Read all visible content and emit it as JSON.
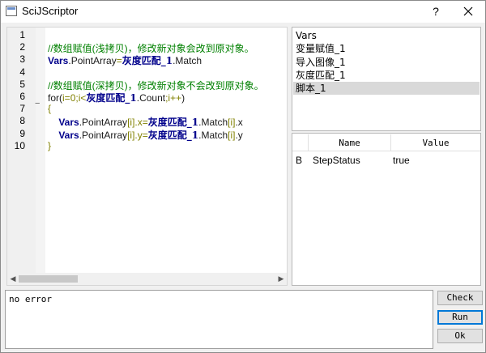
{
  "window": {
    "title": "SciJScriptor",
    "help_label": "?",
    "close_icon": "close-icon"
  },
  "editor": {
    "line_numbers": [
      "1",
      "2",
      "3",
      "4",
      "5",
      "6",
      "7",
      "8",
      "9",
      "10"
    ],
    "lines": [
      [],
      [
        {
          "t": "//数组赋值(浅拷贝)，修改新对象会改到原对象。",
          "c": "comment"
        }
      ],
      [
        {
          "t": "Vars",
          "c": "vars"
        },
        {
          "t": ".PointArray",
          "c": "ident"
        },
        {
          "t": "=",
          "c": "op"
        },
        {
          "t": "灰度匹配_1",
          "c": "zh"
        },
        {
          "t": ".Match",
          "c": "ident"
        }
      ],
      [],
      [
        {
          "t": "//数组赋值(深拷贝)，修改新对象不会改到原对象。",
          "c": "comment"
        }
      ],
      [
        {
          "t": "for",
          "c": "kw"
        },
        {
          "t": "(",
          "c": "ident"
        },
        {
          "t": "i=0;i<",
          "c": "op"
        },
        {
          "t": "灰度匹配_1",
          "c": "zh"
        },
        {
          "t": ".Count",
          "c": "ident"
        },
        {
          "t": ";i++",
          "c": "op"
        },
        {
          "t": ")",
          "c": "ident"
        }
      ],
      [
        {
          "t": "{",
          "c": "op"
        }
      ],
      [
        {
          "t": "    ",
          "c": "ident"
        },
        {
          "t": "Vars",
          "c": "vars"
        },
        {
          "t": ".PointArray",
          "c": "ident"
        },
        {
          "t": "[i]",
          "c": "op"
        },
        {
          "t": ".x=",
          "c": "op"
        },
        {
          "t": "灰度匹配_1",
          "c": "zh"
        },
        {
          "t": ".Match",
          "c": "ident"
        },
        {
          "t": "[i]",
          "c": "op"
        },
        {
          "t": ".x",
          "c": "ident"
        }
      ],
      [
        {
          "t": "    ",
          "c": "ident"
        },
        {
          "t": "Vars",
          "c": "vars"
        },
        {
          "t": ".PointArray",
          "c": "ident"
        },
        {
          "t": "[i]",
          "c": "op"
        },
        {
          "t": ".y=",
          "c": "op"
        },
        {
          "t": "灰度匹配_1",
          "c": "zh"
        },
        {
          "t": ".Match",
          "c": "ident"
        },
        {
          "t": "[i]",
          "c": "op"
        },
        {
          "t": ".y",
          "c": "ident"
        }
      ],
      [
        {
          "t": "}",
          "c": "op"
        }
      ]
    ],
    "fold_marker": "−"
  },
  "variables": {
    "items": [
      "Vars",
      "变量赋值_1",
      "导入图像_1",
      "灰度匹配_1",
      "脚本_1"
    ],
    "selected_index": 4
  },
  "step_table": {
    "columns": [
      "",
      "Name",
      "Value"
    ],
    "rows": [
      {
        "flag": "B",
        "name": "StepStatus",
        "value": "true"
      }
    ]
  },
  "output": {
    "text": "no error"
  },
  "buttons": {
    "check": "Check",
    "run": "Run",
    "ok": "Ok"
  }
}
